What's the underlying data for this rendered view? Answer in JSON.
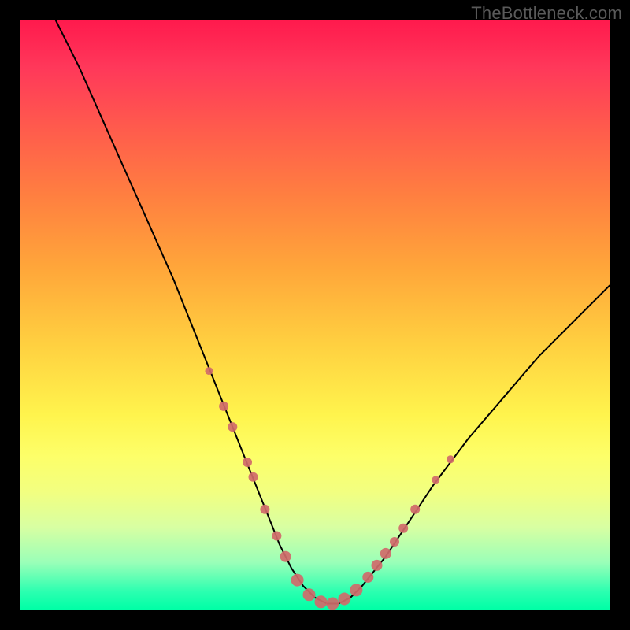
{
  "watermark": "TheBottleneck.com",
  "chart_data": {
    "type": "line",
    "title": "",
    "xlabel": "",
    "ylabel": "",
    "xlim": [
      0,
      100
    ],
    "ylim": [
      0,
      100
    ],
    "series": [
      {
        "name": "bottleneck-curve",
        "x": [
          6,
          10,
          14,
          18,
          22,
          26,
          28,
          30,
          32,
          34,
          36,
          38,
          40,
          42,
          44,
          46,
          48,
          50,
          52,
          54,
          56,
          58,
          62,
          66,
          70,
          76,
          82,
          88,
          94,
          100
        ],
        "y": [
          100,
          92,
          83,
          74,
          65,
          56,
          51,
          46,
          41,
          36,
          31,
          26,
          21,
          16,
          11,
          7,
          4,
          2,
          1,
          1,
          2,
          4,
          9,
          15,
          21,
          29,
          36,
          43,
          49,
          55
        ]
      }
    ],
    "markers": {
      "name": "highlight-points",
      "color": "#d06a6a",
      "points": [
        {
          "x": 32.0,
          "y": 40.5,
          "r": 5
        },
        {
          "x": 34.5,
          "y": 34.5,
          "r": 6
        },
        {
          "x": 36.0,
          "y": 31.0,
          "r": 6
        },
        {
          "x": 38.5,
          "y": 25.0,
          "r": 6
        },
        {
          "x": 39.5,
          "y": 22.5,
          "r": 6
        },
        {
          "x": 41.5,
          "y": 17.0,
          "r": 6
        },
        {
          "x": 43.5,
          "y": 12.5,
          "r": 6
        },
        {
          "x": 45.0,
          "y": 9.0,
          "r": 7
        },
        {
          "x": 47.0,
          "y": 5.0,
          "r": 8
        },
        {
          "x": 49.0,
          "y": 2.5,
          "r": 8
        },
        {
          "x": 51.0,
          "y": 1.3,
          "r": 8
        },
        {
          "x": 53.0,
          "y": 1.0,
          "r": 8
        },
        {
          "x": 55.0,
          "y": 1.8,
          "r": 8
        },
        {
          "x": 57.0,
          "y": 3.3,
          "r": 8
        },
        {
          "x": 59.0,
          "y": 5.5,
          "r": 7
        },
        {
          "x": 60.5,
          "y": 7.5,
          "r": 7
        },
        {
          "x": 62.0,
          "y": 9.5,
          "r": 7
        },
        {
          "x": 63.5,
          "y": 11.5,
          "r": 6
        },
        {
          "x": 65.0,
          "y": 13.8,
          "r": 6
        },
        {
          "x": 67.0,
          "y": 17.0,
          "r": 6
        },
        {
          "x": 70.5,
          "y": 22.0,
          "r": 5
        },
        {
          "x": 73.0,
          "y": 25.5,
          "r": 5
        }
      ]
    }
  }
}
